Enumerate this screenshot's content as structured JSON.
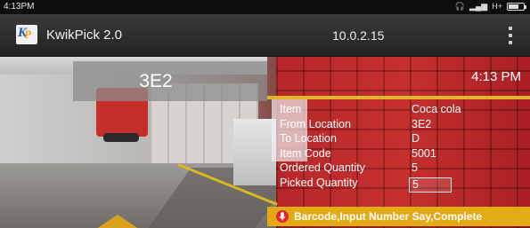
{
  "status_bar": {
    "time": "4:13PM",
    "network_label": "H+",
    "icons": [
      "headphones-icon",
      "signal-icon",
      "battery-icon"
    ]
  },
  "app_bar": {
    "logo_text_1": "K",
    "logo_text_2": "P",
    "title": "KwikPick 2.0",
    "ip_address": "10.0.2.15",
    "menu_icon": "more-vert-icon"
  },
  "main": {
    "location_code": "3E2",
    "time": "4:13 PM",
    "details": [
      {
        "label": "Item",
        "value": "Coca cola"
      },
      {
        "label": "From Location",
        "value": "3E2"
      },
      {
        "label": "To Location",
        "value": "D"
      },
      {
        "label": "Item Code",
        "value": "5001"
      },
      {
        "label": "Ordered Quantity",
        "value": "5"
      }
    ],
    "picked_quantity": {
      "label": "Picked Quantity",
      "value": "5"
    },
    "voice_bar": {
      "icon": "microphone-icon",
      "text": "Barcode,Input Number Say,Complete"
    }
  },
  "colors": {
    "accent": "#e2ab15",
    "app_bar": "#2e2e2e",
    "mic": "#e0262a"
  }
}
